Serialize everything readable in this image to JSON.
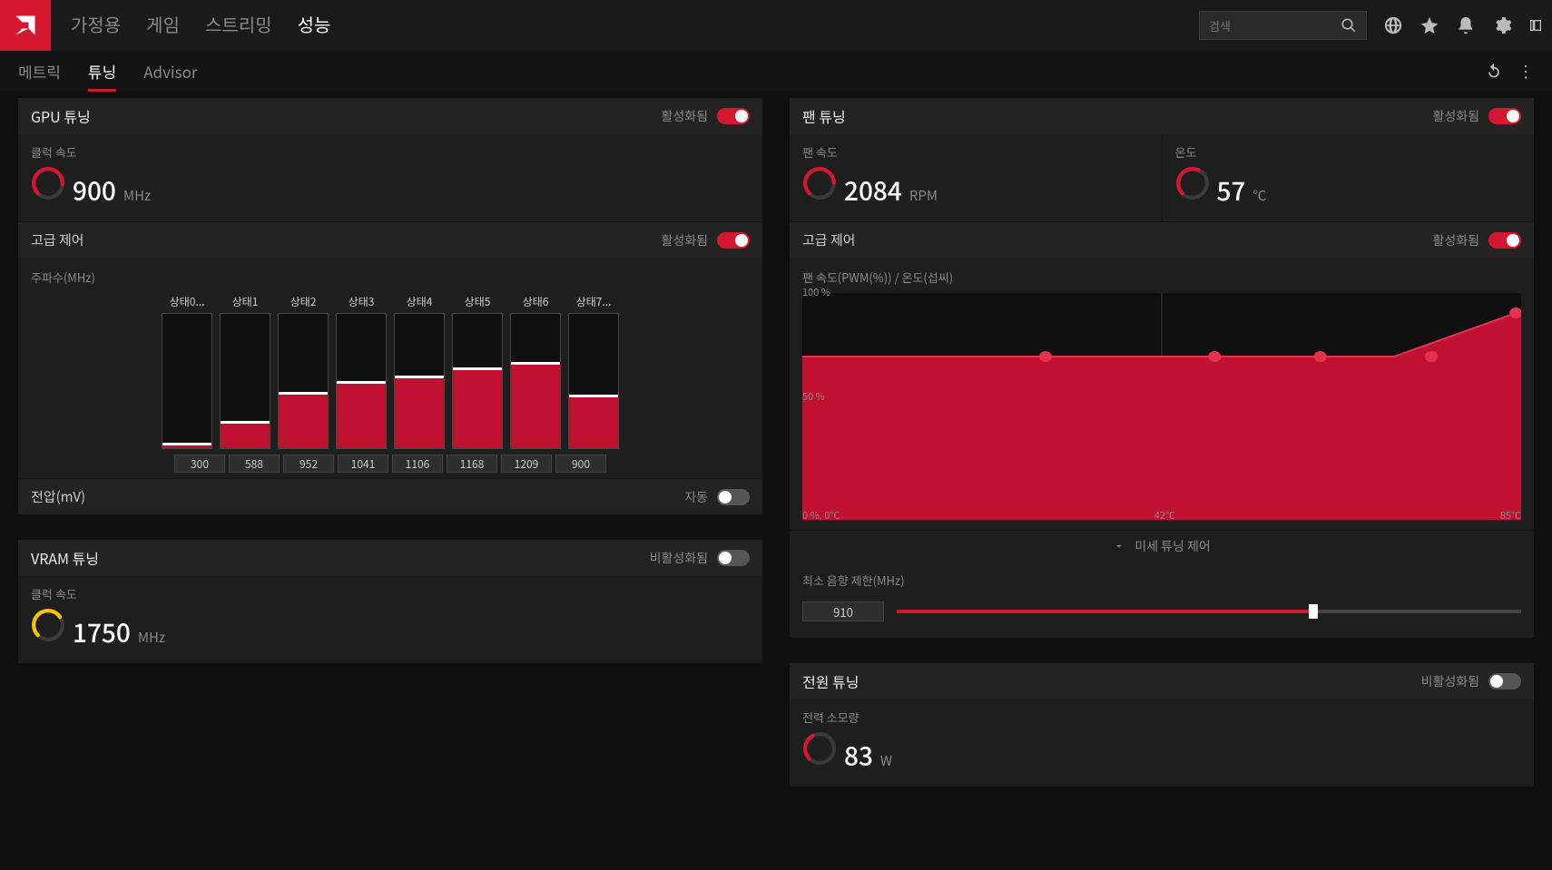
{
  "topbar": {
    "tabs": [
      "가정용",
      "게임",
      "스트리밍",
      "성능"
    ],
    "active_tab": 3,
    "search_placeholder": "검색"
  },
  "subbar": {
    "tabs": [
      "메트릭",
      "튜닝",
      "Advisor"
    ],
    "active_tab": 1
  },
  "gpu_tuning": {
    "title": "GPU 튜닝",
    "enabled_label": "활성화됨",
    "enabled": true,
    "clock": {
      "label": "클럭 속도",
      "value": "900",
      "unit": "MHz",
      "gauge_color": "#d4172f",
      "gauge_pct": 65
    },
    "advanced": {
      "label": "고급 제어",
      "status": "활성화됨",
      "enabled": true
    },
    "freq_chart": {
      "label": "주파수(MHz)",
      "states": [
        "상태0...",
        "상태1",
        "상태2",
        "상태3",
        "상태4",
        "상태5",
        "상태6",
        "상태7..."
      ],
      "bar_pct": [
        2,
        18,
        40,
        48,
        52,
        58,
        62,
        38
      ],
      "values": [
        "300",
        "588",
        "952",
        "1041",
        "1106",
        "1168",
        "1209",
        "900"
      ]
    },
    "voltage": {
      "label": "전압(mV)",
      "status": "자동",
      "enabled": false
    }
  },
  "vram_tuning": {
    "title": "VRAM 튜닝",
    "status": "비활성화됨",
    "enabled": false,
    "clock": {
      "label": "클럭 속도",
      "value": "1750",
      "unit": "MHz",
      "gauge_color": "#f5c400",
      "gauge_pct": 55
    }
  },
  "fan_tuning": {
    "title": "팬 튜닝",
    "enabled_label": "활성화됨",
    "enabled": true,
    "fan_speed": {
      "label": "팬 속도",
      "value": "2084",
      "unit": "RPM",
      "gauge_color": "#d4172f",
      "gauge_pct": 62
    },
    "temp": {
      "label": "온도",
      "value": "57",
      "unit": "℃",
      "gauge_color": "#d4172f",
      "gauge_pct": 45
    },
    "advanced": {
      "label": "고급 제어",
      "status": "활성화됨",
      "enabled": true
    },
    "curve_label": "팬 속도(PWM(%)) / 온도(섭씨)",
    "y_labels": [
      "100 %",
      "50 %",
      "0 %, 0℃"
    ],
    "x_mid": "42℃",
    "x_end": "85℃",
    "fine_tune": "미세 튜닝 제어",
    "min_acoustic": {
      "label": "최소 음향 제한(MHz)",
      "value": "910",
      "pct": 66
    }
  },
  "power_tuning": {
    "title": "전원 튜닝",
    "status": "비활성화됨",
    "enabled": false,
    "power": {
      "label": "전력 소모량",
      "value": "83",
      "unit": "W",
      "gauge_color": "#d4172f",
      "gauge_pct": 30
    }
  },
  "chart_data": [
    {
      "type": "bar",
      "title": "주파수(MHz)",
      "categories": [
        "상태0",
        "상태1",
        "상태2",
        "상태3",
        "상태4",
        "상태5",
        "상태6",
        "상태7"
      ],
      "values": [
        300,
        588,
        952,
        1041,
        1106,
        1168,
        1209,
        900
      ],
      "xlabel": "",
      "ylabel": "MHz",
      "ylim": [
        0,
        1300
      ]
    },
    {
      "type": "area",
      "title": "팬 속도(PWM(%)) / 온도(섭씨)",
      "x": [
        0,
        20,
        35,
        50,
        65,
        85
      ],
      "values": [
        72,
        72,
        72,
        72,
        72,
        92
      ],
      "xlabel": "온도(℃)",
      "ylabel": "PWM %",
      "ylim": [
        0,
        100
      ],
      "xlim": [
        0,
        85
      ]
    }
  ]
}
